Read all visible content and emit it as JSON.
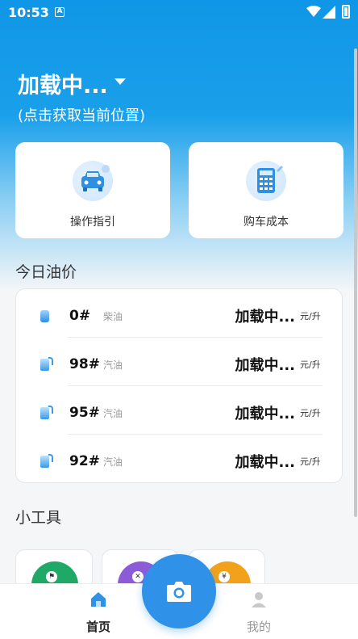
{
  "status_bar": {
    "time": "10:53",
    "notification_badge": "A"
  },
  "location": {
    "title": "加载中...",
    "subtitle": "(点击获取当前位置)"
  },
  "shortcuts": [
    {
      "label": "操作指引",
      "icon": "car-icon"
    },
    {
      "label": "购车成本",
      "icon": "calculator-icon"
    }
  ],
  "oil_section": {
    "title": "今日油价",
    "rows": [
      {
        "grade": "0#",
        "type": "柴油",
        "price": "加载中...",
        "unit": "元/升",
        "icon": "oil-drop-icon"
      },
      {
        "grade": "98#",
        "type": "汽油",
        "price": "加载中...",
        "unit": "元/升",
        "icon": "fuel-pump-icon"
      },
      {
        "grade": "95#",
        "type": "汽油",
        "price": "加载中...",
        "unit": "元/升",
        "icon": "fuel-pump-icon"
      },
      {
        "grade": "92#",
        "type": "汽油",
        "price": "加载中...",
        "unit": "元/升",
        "icon": "fuel-pump-icon"
      }
    ]
  },
  "tools_section": {
    "title": "小工具",
    "tools": [
      {
        "color": "#1fa866",
        "icon": "green-tool-icon"
      },
      {
        "color": "#8e5bd8",
        "icon": "purple-tool-icon"
      },
      {
        "color": "#f2a21a",
        "icon": "orange-tool-icon"
      }
    ]
  },
  "tab_bar": {
    "home_label": "首页",
    "mine_label": "我的",
    "camera": "camera-icon"
  },
  "colors": {
    "primary": "#1aa0ea",
    "accent_button": "#2f92e8"
  }
}
